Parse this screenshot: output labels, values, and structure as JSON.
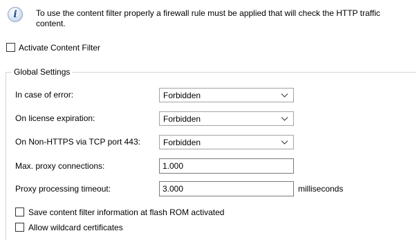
{
  "info": {
    "icon": "info-icon",
    "text": "To use the content filter properly a firewall rule must be applied that will check the HTTP traffic content."
  },
  "activate": {
    "label": "Activate Content Filter",
    "checked": false
  },
  "global_settings": {
    "title": "Global Settings",
    "error": {
      "label": "In case of error:",
      "value": "Forbidden"
    },
    "license": {
      "label": "On license expiration:",
      "value": "Forbidden"
    },
    "non_https": {
      "label": "On Non-HTTPS via TCP port 443:",
      "value": "Forbidden"
    },
    "max_proxy": {
      "label": "Max. proxy connections:",
      "value": "1.000"
    },
    "timeout": {
      "label": "Proxy processing timeout:",
      "value": "3.000",
      "unit": "milliseconds"
    },
    "save_flash": {
      "label": "Save content filter information at flash ROM activated",
      "checked": false
    },
    "wildcard": {
      "label": "Allow wildcard certificates",
      "checked": false
    }
  }
}
